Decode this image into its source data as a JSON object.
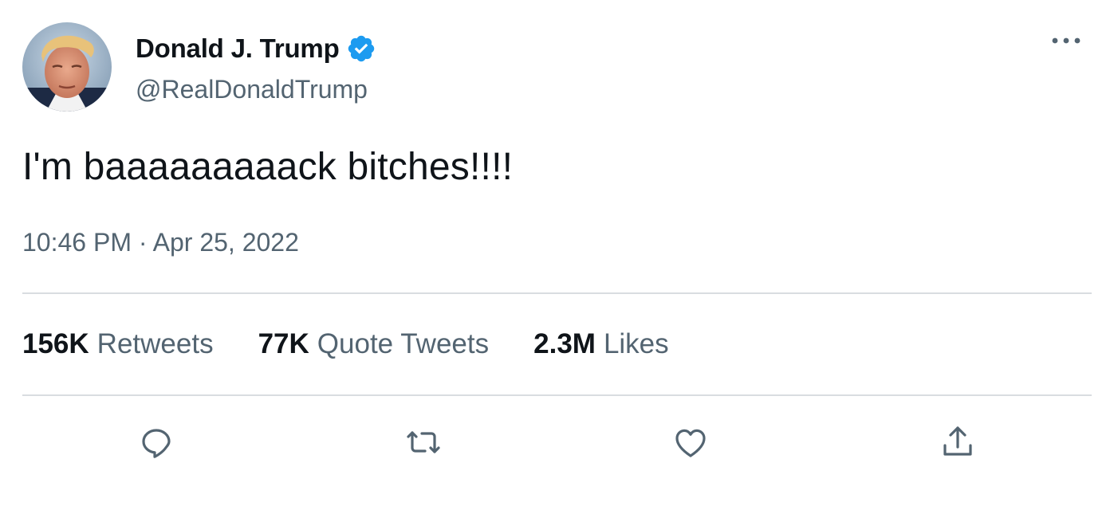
{
  "author": {
    "display_name": "Donald J. Trump",
    "handle": "@RealDonaldTrump",
    "verified": true,
    "avatar_icon": "profile-photo"
  },
  "tweet": {
    "text": "I'm baaaaaaaaack bitches!!!!",
    "timestamp": "10:46 PM · Apr 25, 2022"
  },
  "stats": {
    "retweets": {
      "count": "156K",
      "label": "Retweets"
    },
    "quotes": {
      "count": "77K",
      "label": "Quote Tweets"
    },
    "likes": {
      "count": "2.3M",
      "label": "Likes"
    }
  },
  "actions": [
    {
      "name": "reply",
      "icon": "comment-bubble-icon"
    },
    {
      "name": "retweet",
      "icon": "retweet-arrows-icon"
    },
    {
      "name": "like",
      "icon": "heart-icon"
    },
    {
      "name": "share",
      "icon": "share-upload-icon"
    }
  ],
  "colors": {
    "text_primary": "#0f1419",
    "text_secondary": "#536471",
    "verified_blue": "#1d9bf0",
    "divider": "#d9dde0"
  }
}
